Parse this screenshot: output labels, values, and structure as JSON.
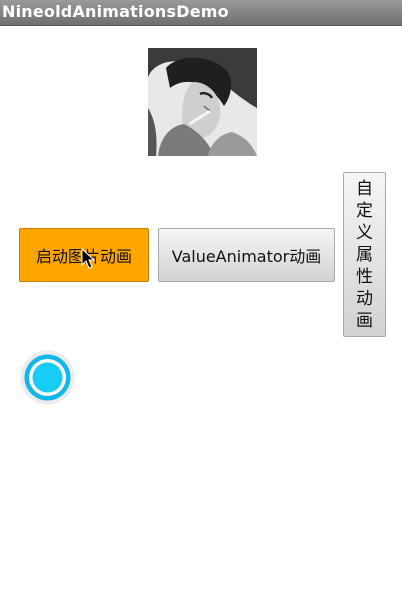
{
  "app": {
    "title": "NineoldAnimationsDemo"
  },
  "buttons": {
    "image_animation": "启动图片动画",
    "value_animator": "ValueAnimator动画",
    "custom_property": [
      "自",
      "定",
      "义",
      "属",
      "性",
      "动",
      "画"
    ]
  },
  "icons": {
    "photo": "portrait-photo-icon",
    "cursor": "mouse-pointer-icon",
    "ball": "animated-ball-icon"
  },
  "colors": {
    "titlebar": "#7d7d7d",
    "orange_button": "#ffa500",
    "ball_fill": "#18cdf5",
    "ball_ring": "#0fb7eb"
  }
}
